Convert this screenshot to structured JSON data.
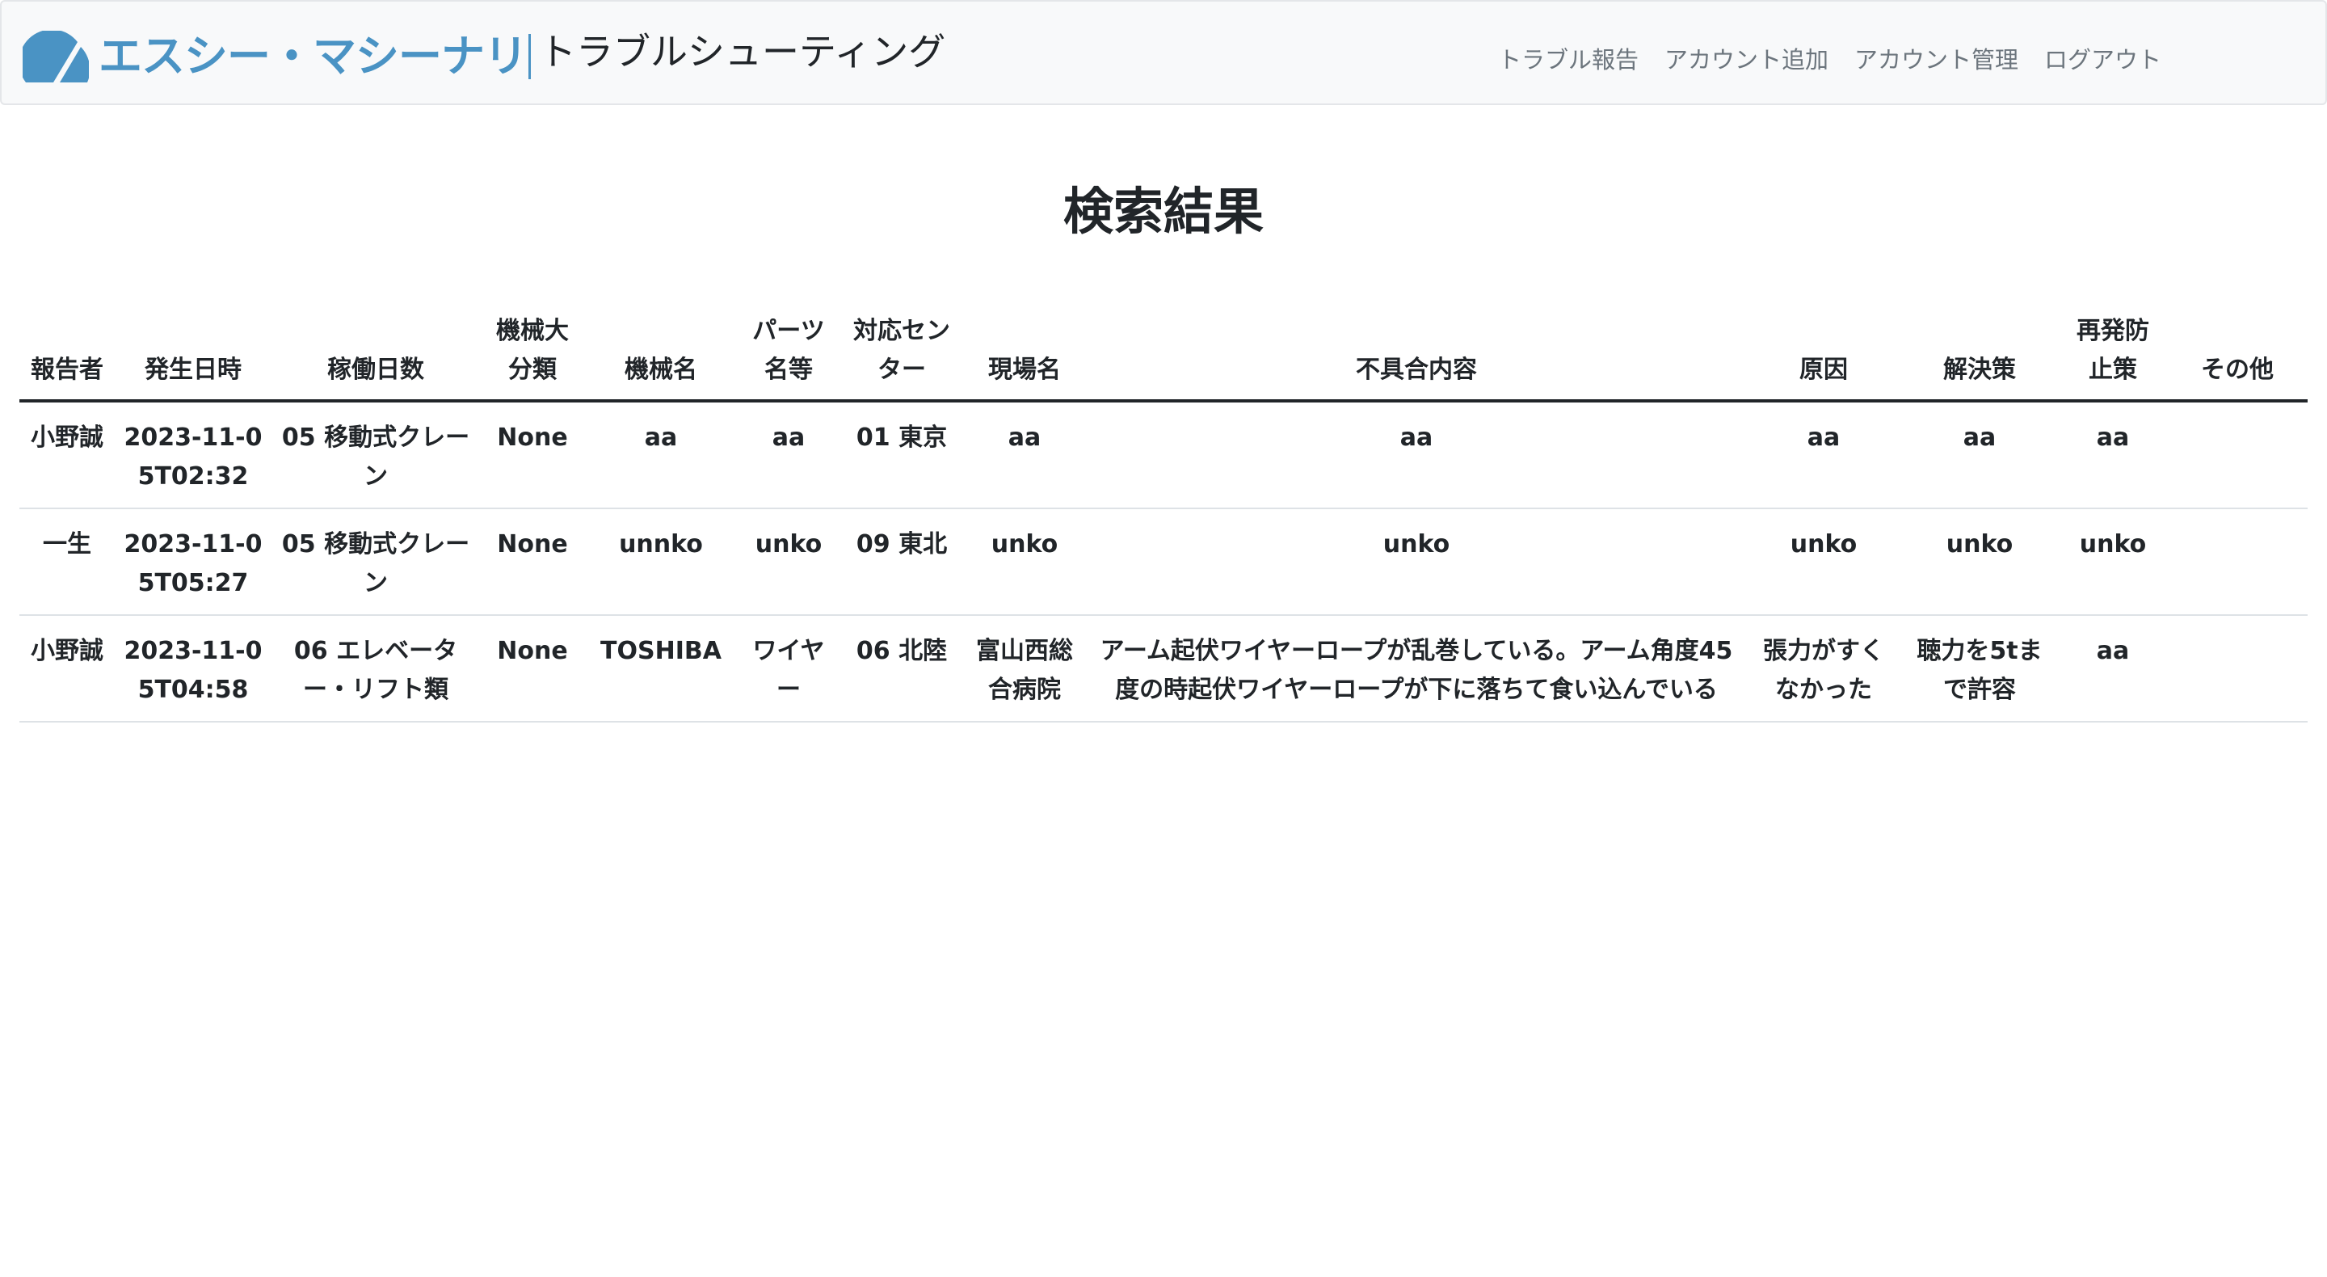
{
  "navbar": {
    "logo_text": "エスシー・マシーナリ",
    "app_title": "トラブルシューティング",
    "links": [
      "トラブル報告",
      "アカウント追加",
      "アカウント管理",
      "ログアウト"
    ],
    "brand_color": "#4a93c4",
    "background": "#f8f9fa"
  },
  "page": {
    "title": "検索結果"
  },
  "table": {
    "headers": [
      "報告者",
      "発生日時",
      "稼働日数",
      "機械大分類",
      "機械名",
      "パーツ名等",
      "対応センター",
      "現場名",
      "不具合内容",
      "原因",
      "解決策",
      "再発防止策",
      "その他"
    ],
    "rows": [
      [
        "小野誠",
        "2023-11-05T02:32",
        "05 移動式クレーン",
        "None",
        "aa",
        "aa",
        "01 東京",
        "aa",
        "aa",
        "aa",
        "aa",
        "aa",
        ""
      ],
      [
        "一生",
        "2023-11-05T05:27",
        "05 移動式クレーン",
        "None",
        "unnko",
        "unko",
        "09 東北",
        "unko",
        "unko",
        "unko",
        "unko",
        "unko",
        ""
      ],
      [
        "小野誠",
        "2023-11-05T04:58",
        "06 エレベーター・リフト類",
        "None",
        "TOSHIBA",
        "ワイヤー",
        "06 北陸",
        "富山西総合病院",
        "アーム起伏ワイヤーロープが乱巻している。アーム角度45度の時起伏ワイヤーロープが下に落ちて食い込んでいる",
        "張力がすくなかった",
        "聴力を5tまで許容",
        "aa",
        ""
      ]
    ]
  }
}
